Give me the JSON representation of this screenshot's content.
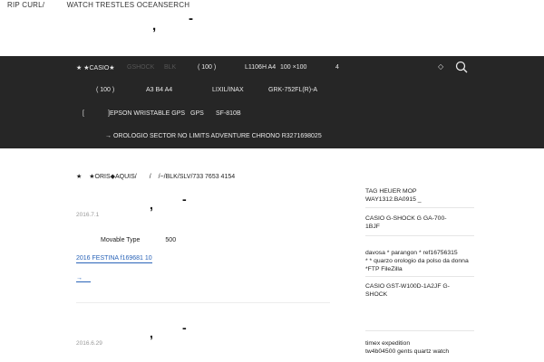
{
  "top_links": [
    "RIP CURL/",
    "WATCH TRESTLES OCEANSERCH"
  ],
  "site_title": {
    "comma": ",",
    "dash": "-"
  },
  "nav": {
    "row1": {
      "star_item": "★  ★CASIO★",
      "dim_a": "GSHOCK",
      "dim_b": "BLK",
      "paren": "(      100      )",
      "model": "L1106H A4",
      "qty": "100   ×100",
      "num": "4",
      "diamond": "◇"
    },
    "row2": {
      "paren": "(      100      )",
      "paper": "A3 B4 A4",
      "brand": "LIXIL/INAX",
      "part": "GRK-752FL(R)-A"
    },
    "row3": {
      "bracket": "[",
      "epson": "]EPSON WRISTABLE GPS",
      "gps": "GPS",
      "model": "SF-810B"
    },
    "row4": {
      "arrow_item": "→  OROLOGIO SECTOR NO LIMITS ADVENTURE CHRONO R3271698025"
    }
  },
  "crumb": [
    "★",
    "★ORIS◆AQUIS/",
    "/",
    "/~/BLK/SLV/733 7653 4154"
  ],
  "post1": {
    "date": "2016.7.1",
    "comma": ",",
    "dash": "-",
    "body_a": "Movable Type",
    "body_b": "500",
    "link": "2016        FESTINA                                                          f169681    10",
    "more": "→"
  },
  "post2": {
    "date": "2016.6.29",
    "comma": ",",
    "dash": "-"
  },
  "sidebar": [
    {
      "lines": [
        "TAG HEUER                            MOP",
        "WAY1312.BA0915                             _"
      ]
    },
    {
      "lines": [
        "CASIO    G-SHOCK      G    GA-700-",
        "1BJF"
      ]
    },
    {
      "lines": [
        "     davosa * parangon * ref16756315",
        "* * quarzo orologio da polso da donna",
        "*FTP   FileZilla"
      ]
    },
    {
      "lines": [
        "     CASIO GST-W100D-1A2JF G-",
        "SHOCK"
      ]
    },
    {
      "lines": [
        "                        timex expedition",
        "tw4b04500 gents quartz watch"
      ]
    }
  ],
  "colors": {
    "nav_bg": "#262626",
    "link": "#2a64b8"
  }
}
